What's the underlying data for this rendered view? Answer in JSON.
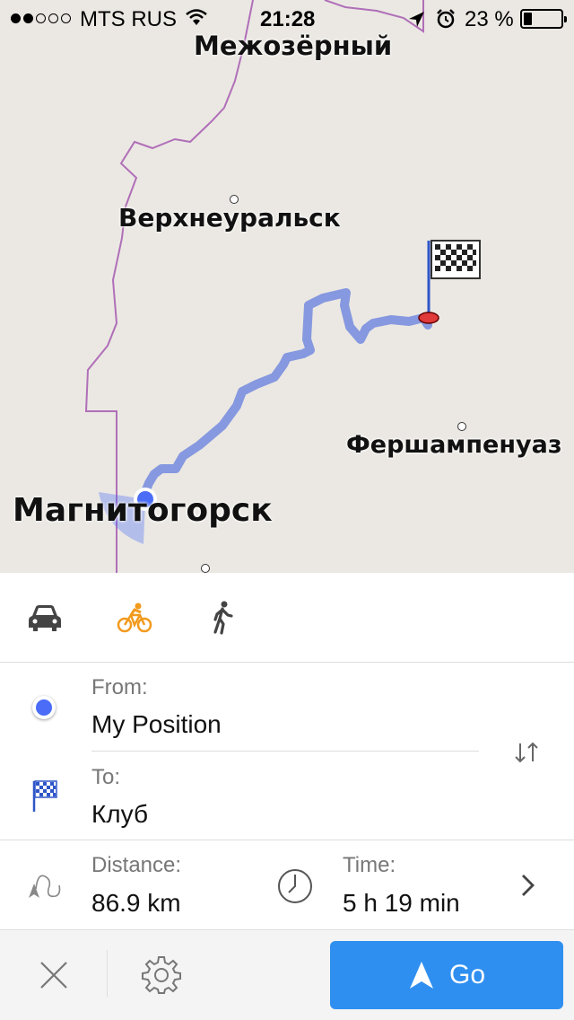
{
  "status_bar": {
    "carrier": "MTS RUS",
    "time": "21:28",
    "battery_percent": "23 %",
    "battery_level": 0.23,
    "signal_bars_filled": 2,
    "signal_bars_total": 5
  },
  "map": {
    "cities": {
      "mezhozerny": "Межозёрный",
      "verkhneuralsk": "Верхнеуральск",
      "fershampenuaz": "Фершампенуаз",
      "magnitogorsk": "Магнитогорск"
    },
    "colors": {
      "route": "#7b8fde",
      "border": "#b06fb8",
      "background": "#ebe8e3"
    }
  },
  "transport_modes": {
    "car": "car-icon",
    "bicycle": "bicycle-icon",
    "walk": "walk-icon",
    "selected": "bicycle",
    "active_color": "#f29a1d"
  },
  "route": {
    "from_label": "From:",
    "from_value": "My Position",
    "to_label": "To:",
    "to_value": "Клуб"
  },
  "summary": {
    "distance_label": "Distance:",
    "distance_value": "86.9 km",
    "time_label": "Time:",
    "time_value": "5 h 19 min"
  },
  "bottom_bar": {
    "go_label": "Go",
    "go_color": "#2f8ff0"
  }
}
